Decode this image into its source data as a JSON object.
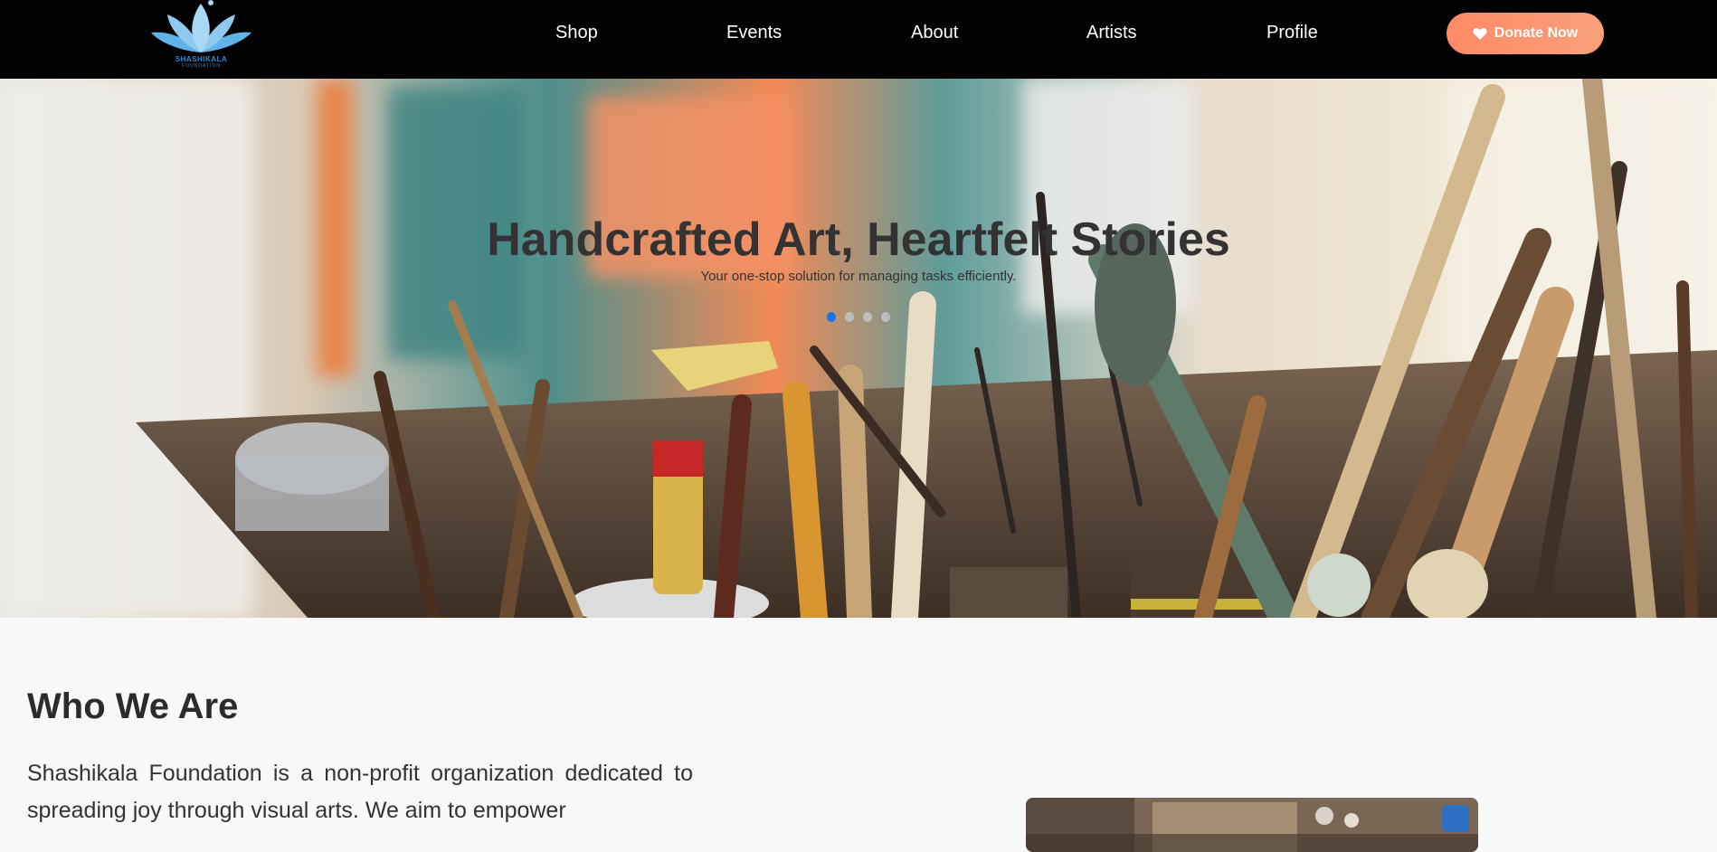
{
  "brand": {
    "name": "SHASHIKALA",
    "tagline": "FOUNDATION",
    "logo_icon": "lotus-icon",
    "logo_color": "#8fc9ee"
  },
  "nav": {
    "items": [
      {
        "label": "Shop"
      },
      {
        "label": "Events"
      },
      {
        "label": "About"
      },
      {
        "label": "Artists"
      },
      {
        "label": "Profile"
      }
    ],
    "donate_label": "Donate Now",
    "donate_icon": "heart-icon",
    "donate_color": "#ff8a67"
  },
  "hero": {
    "title": "Handcrafted Art, Heartfelt Stories",
    "subtitle": "Your one-stop solution for managing tasks efficiently.",
    "slide_count": 4,
    "active_slide": 1,
    "active_dot_color": "#1a73e8"
  },
  "about": {
    "title": "Who We Are",
    "text": "Shashikala Foundation is a non-profit organization dedicated to spreading joy through visual arts. We aim to empower"
  }
}
